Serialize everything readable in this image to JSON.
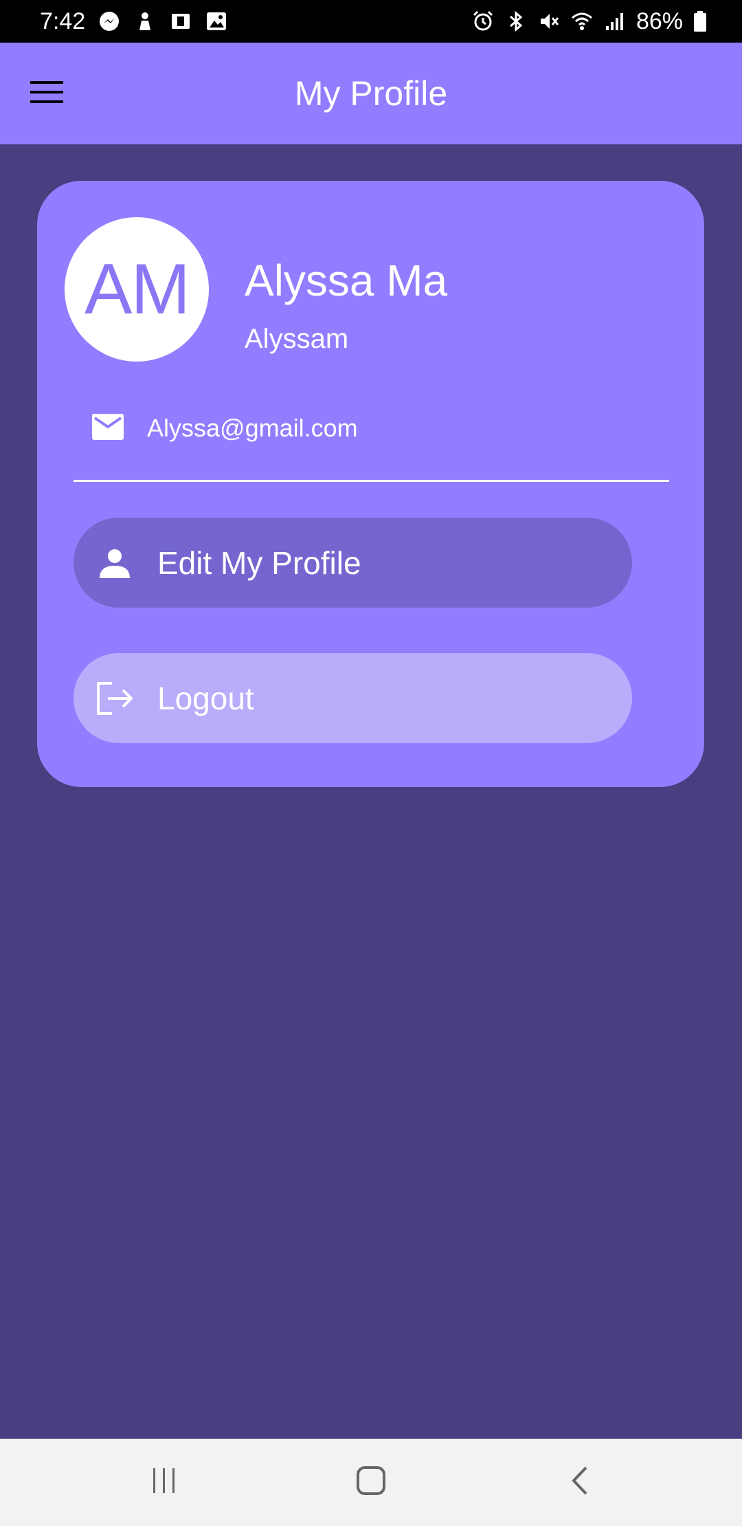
{
  "status_bar": {
    "time": "7:42",
    "battery": "86%",
    "left_icons": [
      "messenger-icon",
      "notification-icon",
      "cast-icon",
      "image-icon"
    ],
    "right_icons": [
      "alarm-icon",
      "bluetooth-icon",
      "mute-icon",
      "wifi-icon",
      "signal-icon",
      "battery-icon"
    ]
  },
  "app_bar": {
    "title": "My Profile",
    "menu_icon": "menu-icon"
  },
  "profile": {
    "initials": "AM",
    "name": "Alyssa Ma",
    "username": "Alyssam",
    "email": "Alyssa@gmail.com"
  },
  "actions": {
    "edit_label": "Edit My Profile",
    "logout_label": "Logout"
  },
  "colors": {
    "background": "#483e80",
    "accent": "#917dff",
    "edit_button": "#7566cf",
    "logout_button": "#b9acfb",
    "avatar_text": "#8b77f5"
  },
  "nav_bar": {
    "icons": [
      "recents-icon",
      "home-icon",
      "back-icon"
    ]
  }
}
